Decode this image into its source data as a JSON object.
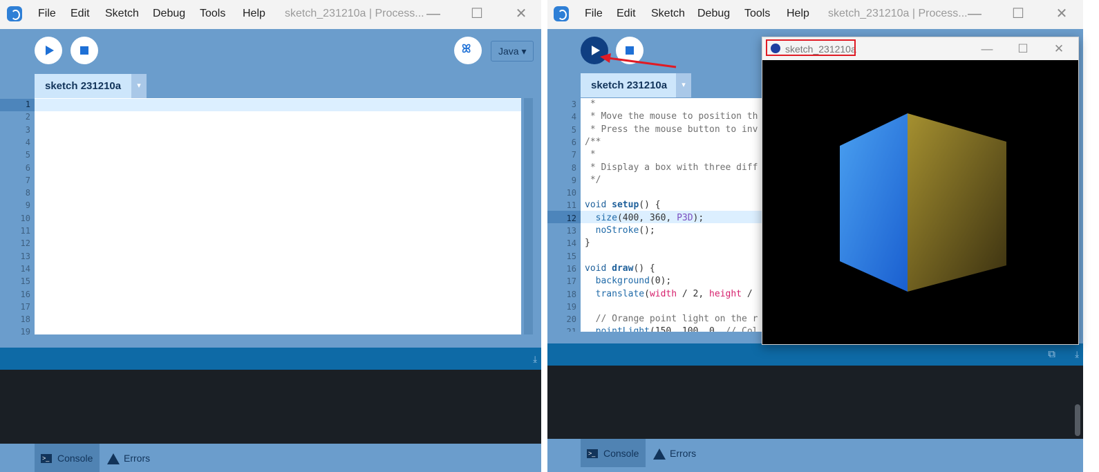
{
  "left_window": {
    "menu": [
      "File",
      "Edit",
      "Sketch",
      "Debug",
      "Tools",
      "Help"
    ],
    "title": "sketch_231210a | Process...",
    "mode": "Java ▾",
    "tab_label": "sketch 231210a",
    "tab_arrow": "▾",
    "line_numbers": [
      "1",
      "2",
      "3",
      "4",
      "5",
      "6",
      "7",
      "8",
      "9",
      "10",
      "11",
      "12",
      "13",
      "14",
      "15",
      "16",
      "17",
      "18",
      "19"
    ],
    "footer": {
      "console": "Console",
      "errors": "Errors"
    }
  },
  "right_window": {
    "menu": [
      "File",
      "Edit",
      "Sketch",
      "Debug",
      "Tools",
      "Help"
    ],
    "title": "sketch_231210a | Process...",
    "tab_label": "sketch 231210a",
    "tab_arrow": "▾",
    "line_numbers": [
      "3",
      "4",
      "5",
      "6",
      "7",
      "8",
      "9",
      "10",
      "11",
      "12",
      "13",
      "14",
      "15",
      "16",
      "17",
      "18",
      "19",
      "20",
      "21"
    ],
    "code_lines": [
      " *",
      " * Move the mouse to position th",
      " * Press the mouse button to inv",
      "/**",
      " *",
      " * Display a box with three diff",
      " */",
      "",
      "void setup() {",
      "  size(400, 360, P3D);",
      "  noStroke();",
      "}",
      "",
      "void draw() {",
      "  background(0);",
      "  translate(width / 2, height /",
      "",
      "  // Orange point light on the r",
      "  pointLight(150, 100, 0, // Col"
    ],
    "footer": {
      "console": "Console",
      "errors": "Errors"
    }
  },
  "sketch_window": {
    "title": "sketch_231210a",
    "controls": {
      "minimize": "—",
      "maximize": "☐",
      "close": "✕"
    },
    "cube_colors": {
      "left_face": "#2f7be0",
      "right_face": "#7a6a1f",
      "background": "#000000"
    }
  },
  "window_controls": {
    "minimize": "—",
    "maximize": "☐",
    "close": "✕"
  },
  "annotation_color": "#e01b24"
}
